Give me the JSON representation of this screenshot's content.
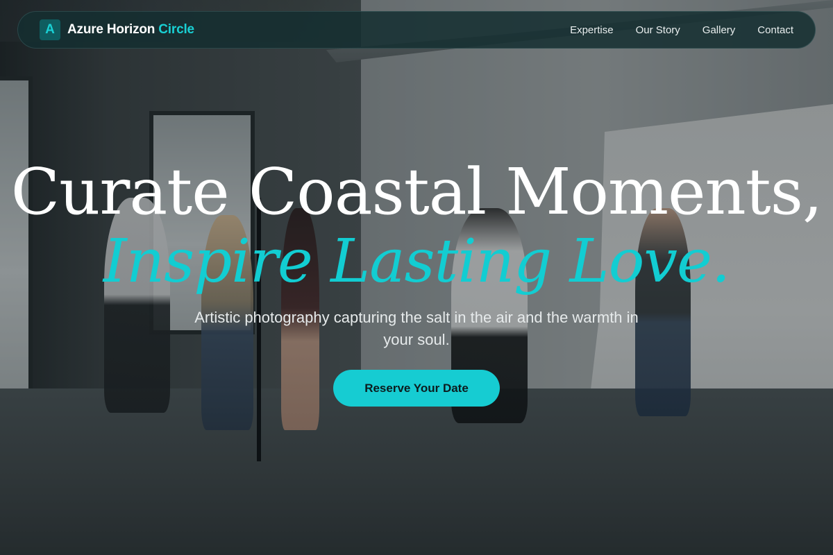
{
  "brand": {
    "mark": "A",
    "name_primary": "Azure Horizon",
    "name_accent": "Circle",
    "accent_color": "#19d0d4"
  },
  "nav": {
    "items": [
      {
        "label": "Expertise"
      },
      {
        "label": "Our Story"
      },
      {
        "label": "Gallery"
      },
      {
        "label": "Contact"
      }
    ]
  },
  "hero": {
    "headline_line1": "Curate Coastal Moments,",
    "headline_line2": "Inspire Lasting Love.",
    "subtitle": "Artistic photography capturing the salt in the air and the warmth in your soul.",
    "cta_label": "Reserve Your Date",
    "cta_color": "#16ccd2",
    "background_image": "photography-studio-photo"
  }
}
